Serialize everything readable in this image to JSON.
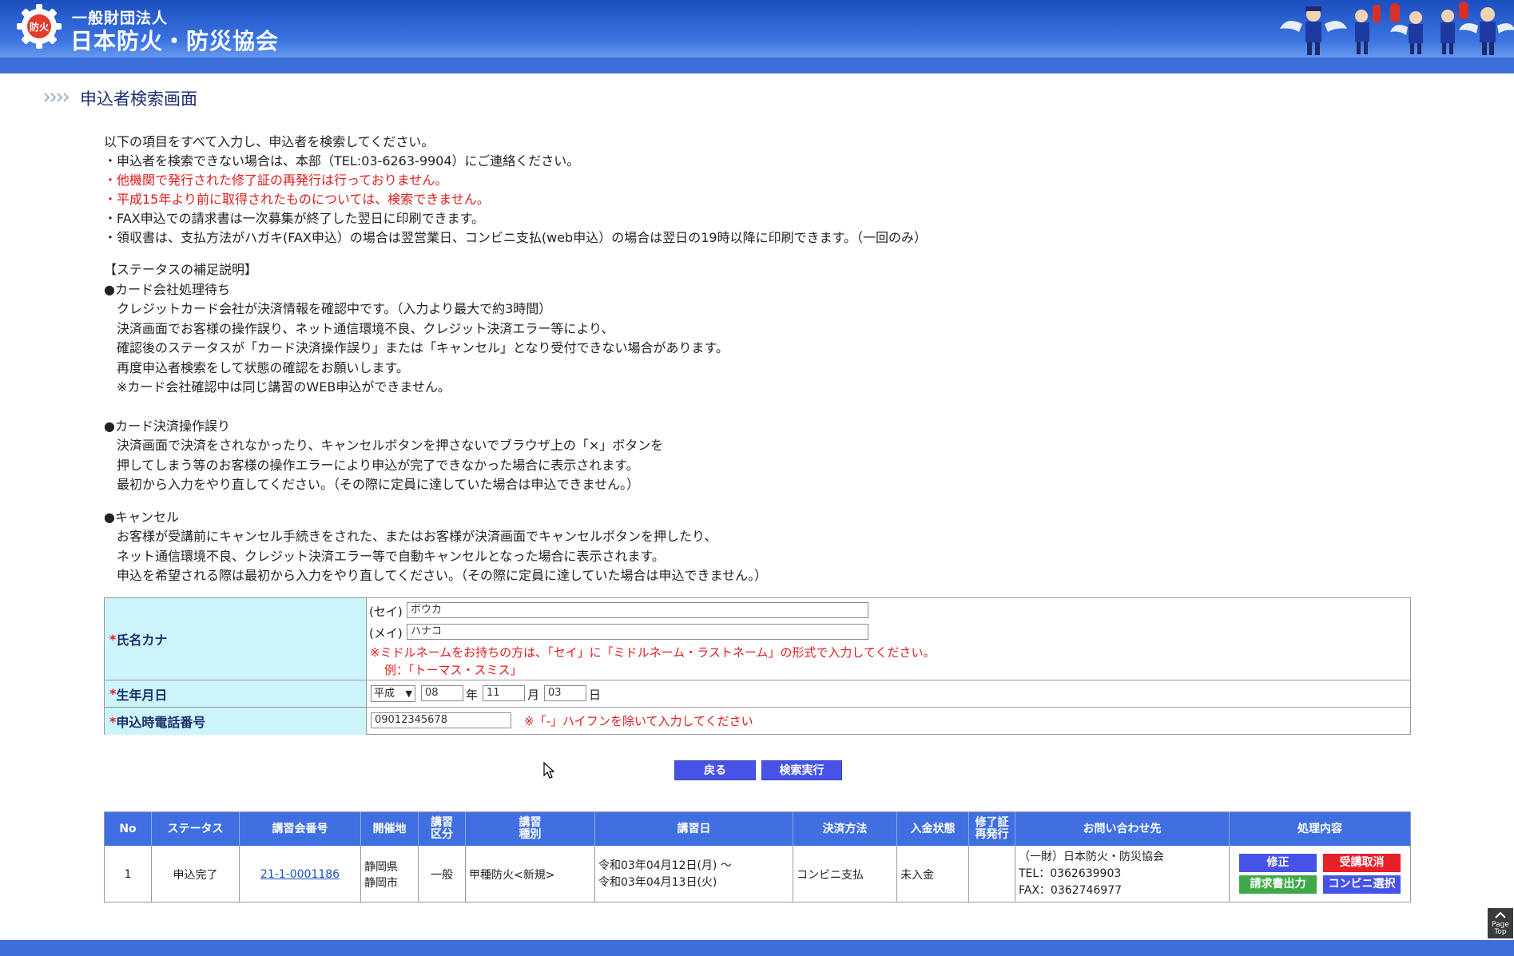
{
  "header": {
    "org_line1": "一般財団法人",
    "org_line2": "日本防火・防災協会",
    "seal_text": "防火"
  },
  "page_title": "申込者検索画面",
  "intro_lines": [
    {
      "text": "以下の項目をすべて入力し、申込者を検索してください。",
      "red": false
    },
    {
      "text": "・申込者を検索できない場合は、本部（TEL:03-6263-9904）にご連絡ください。",
      "red": false
    },
    {
      "text": "・他機関で発行された修了証の再発行は行っておりません。",
      "red": true
    },
    {
      "text": "・平成15年より前に取得されたものについては、検索できません。",
      "red": true
    },
    {
      "text": "・FAX申込での請求書は一次募集が終了した翌日に印刷できます。",
      "red": false
    },
    {
      "text": "・領収書は、支払方法がハガキ(FAX申込）の場合は翌営業日、コンビニ支払(web申込）の場合は翌日の19時以降に印刷できます。（一回のみ）",
      "red": false
    }
  ],
  "status": {
    "heading": "【ステータスの補足説明】",
    "card_pending_title": "●カード会社処理待ち",
    "card_pending_lines": [
      "クレジットカード会社が決済情報を確認中です。（入力より最大で約3時間）",
      "決済画面でお客様の操作誤り、ネット通信環境不良、クレジット決済エラー等により、",
      "確認後のステータスが「カード決済操作誤り」または「キャンセル」となり受付できない場合があります。",
      "再度申込者検索をして状態の確認をお願いします。",
      "※カード会社確認中は同じ講習のWEB申込ができません。"
    ],
    "card_error_title": "●カード決済操作誤り",
    "card_error_lines": [
      "決済画面で決済をされなかったり、キャンセルボタンを押さないでブラウザ上の「×」ボタンを",
      "押してしまう等のお客様の操作エラーにより申込が完了できなかった場合に表示されます。",
      "最初から入力をやり直してください。（その際に定員に達していた場合は申込できません。）"
    ],
    "cancel_title": "●キャンセル",
    "cancel_lines": [
      "お客様が受講前にキャンセル手続きをされた、またはお客様が決済画面でキャンセルボタンを押したり、",
      "ネット通信環境不良、クレジット決済エラー等で自動キャンセルとなった場合に表示されます。",
      "申込を希望される際は最初から入力をやり直してください。（その際に定員に達していた場合は申込できません。）"
    ]
  },
  "form": {
    "required_mark": "*",
    "name_kana": {
      "label": "氏名カナ",
      "sei_label": "(セイ)",
      "sei_value": "ボウカ",
      "mei_label": "(メイ)",
      "mei_value": "ハナコ",
      "note1": "※ミドルネームをお持ちの方は、「セイ」に「ミドルネーム・ラストネーム」の形式で入力してください。",
      "note2": "例：「トーマス・スミス」"
    },
    "birthdate": {
      "label": "生年月日",
      "era": "平成",
      "year": "08",
      "year_unit": "年",
      "month": "11",
      "month_unit": "月",
      "day": "03",
      "day_unit": "日"
    },
    "phone": {
      "label": "申込時電話番号",
      "value": "09012345678",
      "note": "※「-」ハイフンを除いて入力してください"
    }
  },
  "buttons": {
    "back": "戻る",
    "search": "検索実行"
  },
  "results": {
    "headers": [
      "No",
      "ステータス",
      "講習会番号",
      "開催地",
      "講習\n区分",
      "講習\n種別",
      "講習日",
      "決済方法",
      "入金状態",
      "修了証\n再発行",
      "お問い合わせ先",
      "処理内容"
    ],
    "rows": [
      {
        "no": "1",
        "status": "申込完了",
        "course_no": "21-1-0001186",
        "venue_line1": "静岡県",
        "venue_line2": "静岡市",
        "category": "一般",
        "type": "甲種防火<新規>",
        "date_line1": "令和03年04月12日(月) 〜",
        "date_line2": "令和03年04月13日(火)",
        "payment": "コンビニ支払",
        "deposit": "未入金",
        "reissue": "",
        "contact_line1": "（一財）日本防火・防災協会",
        "contact_line2": "TEL：0362639903",
        "contact_line3": "FAX：0362746977",
        "actions": {
          "edit": "修正",
          "cancel": "受講取消",
          "invoice": "請求書出力",
          "convenience": "コンビニ選択"
        }
      }
    ]
  },
  "page_top_label": [
    "Page",
    "Top"
  ],
  "colors": {
    "header_blue": "#3b74e0",
    "required_red": "#e01c1c",
    "table_header_blue": "#3f6fe0",
    "button_blue": "#4653e6",
    "button_red": "#e8202a",
    "button_green": "#3ea84a",
    "label_bg": "#ccf5fb"
  }
}
